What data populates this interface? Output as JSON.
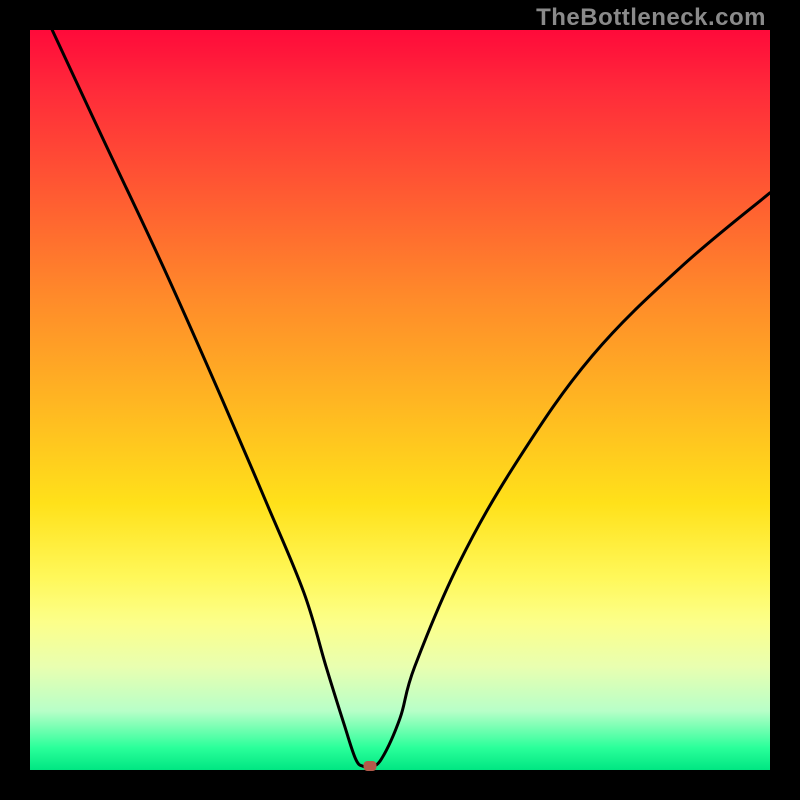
{
  "watermark": "TheBottleneck.com",
  "chart_data": {
    "type": "line",
    "title": "",
    "xlabel": "",
    "ylabel": "",
    "xlim": [
      0,
      100
    ],
    "ylim": [
      0,
      100
    ],
    "series": [
      {
        "name": "bottleneck-curve",
        "x": [
          3,
          10,
          18,
          26,
          32,
          37,
          40,
          42.5,
          44,
          45,
          46,
          47.5,
          50,
          52,
          58,
          66,
          76,
          88,
          100
        ],
        "values": [
          100,
          85,
          68,
          50,
          36,
          24,
          14,
          6,
          1.5,
          0.5,
          0.5,
          1.5,
          7,
          14,
          28,
          42,
          56,
          68,
          78
        ]
      }
    ],
    "marker": {
      "x": 46,
      "y": 0.5
    },
    "gradient_stops": [
      {
        "pos": 0,
        "color": "#ff0a3a"
      },
      {
        "pos": 50,
        "color": "#ffe11a"
      },
      {
        "pos": 100,
        "color": "#00e682"
      }
    ]
  }
}
